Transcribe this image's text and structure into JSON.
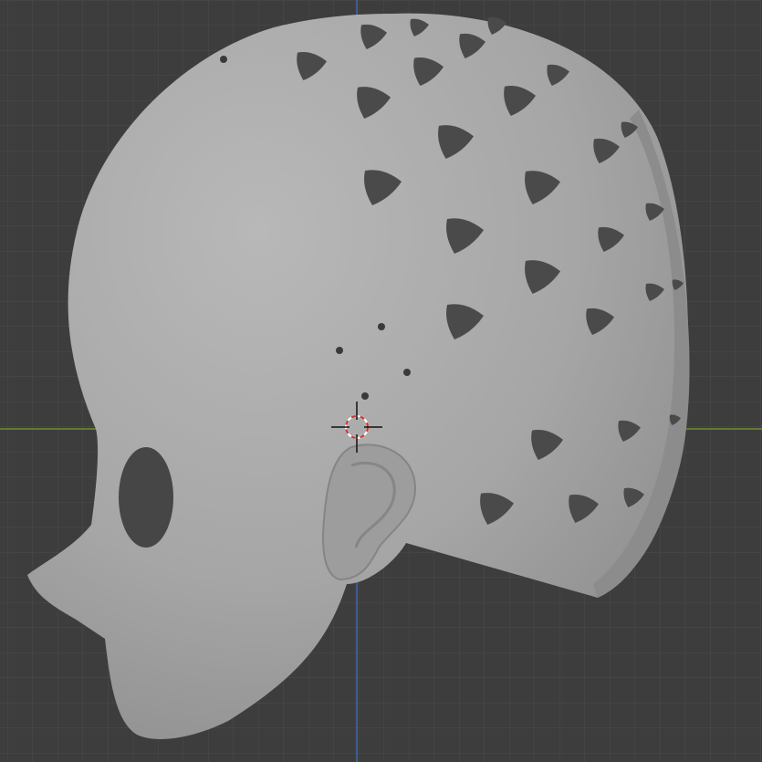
{
  "viewport": {
    "background": "#3d3d3d",
    "grid_color": "#4a4a4a",
    "x_axis_color": "#6f8f2f",
    "y_axis_color": "#3f6aa8",
    "model_color": "#a9a9a9",
    "hole_color": "#4a4a4a"
  },
  "icons": {
    "cursor": "3d-cursor-icon"
  }
}
